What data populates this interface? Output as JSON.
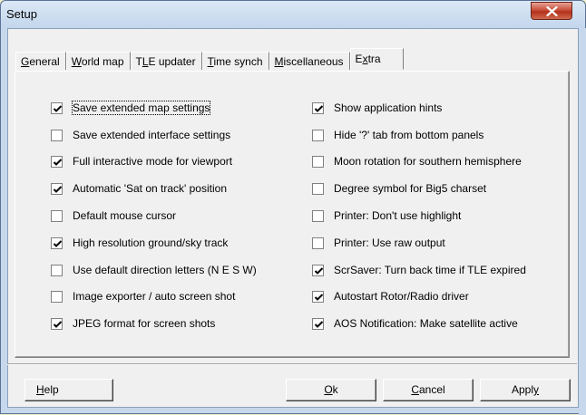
{
  "window": {
    "title": "Setup",
    "close_icon": "close-x-icon"
  },
  "tabs": [
    {
      "label": "General",
      "mnemonic": "G",
      "rest": "eneral",
      "active": false
    },
    {
      "label": "World map",
      "mnemonic": "W",
      "rest": "orld map",
      "active": false
    },
    {
      "label": "TLE updater",
      "pre": "T",
      "mnemonic": "L",
      "rest": "E updater",
      "active": false
    },
    {
      "label": "Time synch",
      "mnemonic": "T",
      "rest": "ime synch",
      "active": false
    },
    {
      "label": "Miscellaneous",
      "mnemonic": "M",
      "rest": "iscellaneous",
      "active": false
    },
    {
      "label": "Extra",
      "pre": "E",
      "mnemonic": "x",
      "rest": "tra",
      "active": true
    }
  ],
  "left_options": [
    {
      "label": "Save extended map settings",
      "checked": true
    },
    {
      "label": "Save extended interface settings",
      "checked": false
    },
    {
      "label": "Full interactive mode for viewport",
      "checked": true
    },
    {
      "label": "Automatic 'Sat on track' position",
      "checked": true
    },
    {
      "label": "Default mouse cursor",
      "checked": false
    },
    {
      "label": "High resolution ground/sky track",
      "checked": true
    },
    {
      "label": "Use default direction letters (N E S W)",
      "checked": false
    },
    {
      "label": "Image exporter / auto screen shot",
      "checked": false
    },
    {
      "label": "JPEG format for screen shots",
      "checked": true
    }
  ],
  "right_options": [
    {
      "label": "Show application hints",
      "checked": true
    },
    {
      "label": "Hide '?' tab from bottom panels",
      "checked": false
    },
    {
      "label": "Moon rotation for southern hemisphere",
      "checked": false
    },
    {
      "label": "Degree symbol for Big5 charset",
      "checked": false
    },
    {
      "label": "Printer: Don't use highlight",
      "checked": false
    },
    {
      "label": "Printer: Use raw output",
      "checked": false
    },
    {
      "label": "ScrSaver: Turn back time if TLE expired",
      "checked": true
    },
    {
      "label": "Autostart Rotor/Radio driver",
      "checked": true
    },
    {
      "label": "AOS Notification: Make satellite active",
      "checked": true
    }
  ],
  "buttons": {
    "help": {
      "mnemonic": "H",
      "rest": "elp"
    },
    "ok": {
      "mnemonic": "O",
      "rest": "k"
    },
    "cancel": {
      "mnemonic": "C",
      "rest": "ancel"
    },
    "apply": {
      "pre": "Appl",
      "mnemonic": "y",
      "rest": ""
    }
  }
}
